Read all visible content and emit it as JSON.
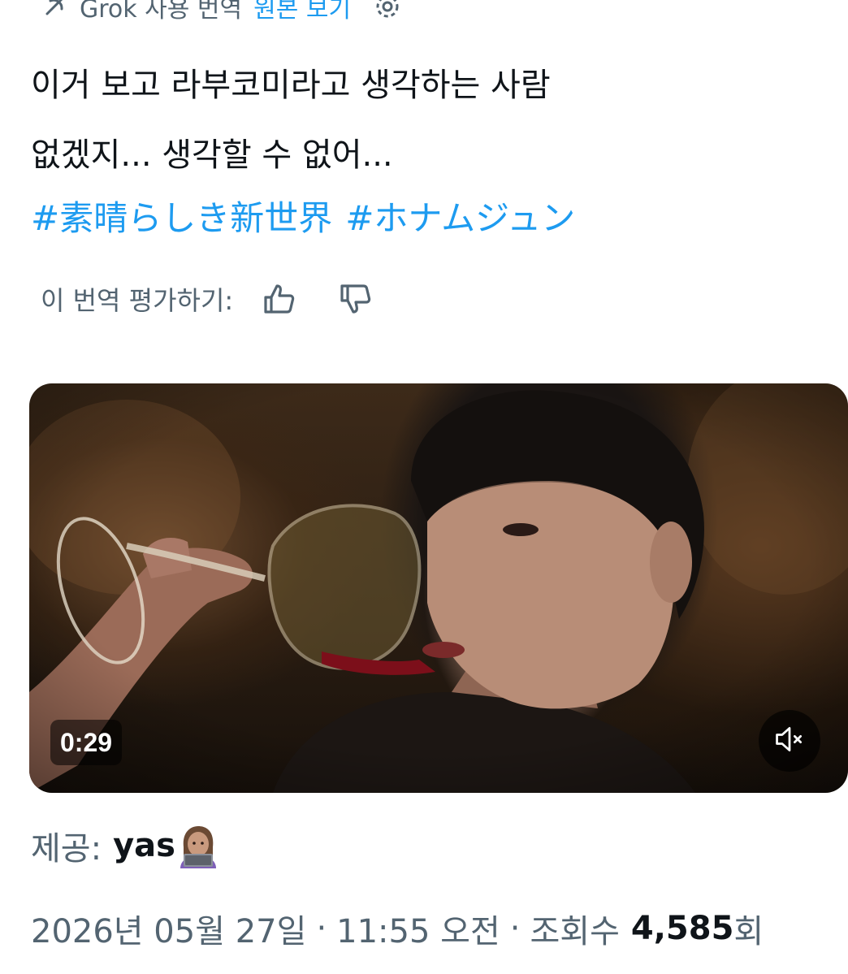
{
  "translation_bar": {
    "source": "Grok 사용 번역",
    "show_original": "원본 보기",
    "grok_icon": "grok-logo-icon",
    "settings_icon": "gear-icon"
  },
  "tweet": {
    "line1": "이거 보고 라부코미라고 생각하는 사람",
    "line2": "없겠지... 생각할 수 없어...",
    "hashtags": [
      "#素晴らしき新世界",
      "#ホナムジュン"
    ]
  },
  "rate_translation": {
    "label": "이 번역 평가하기:",
    "like_icon": "thumbs-up-icon",
    "dislike_icon": "thumbs-down-icon"
  },
  "video": {
    "duration": "0:29",
    "mute_icon": "speaker-muted-icon"
  },
  "credit": {
    "label": "제공:",
    "name": "yas",
    "emoji": "woman-technologist-emoji"
  },
  "meta": {
    "date": "2026년 05월 27일",
    "separator": "·",
    "time": "11:55 오전",
    "views_label": "조회수",
    "views_count": "4,585",
    "views_suffix": "회"
  },
  "colors": {
    "text_primary": "#0f1419",
    "text_secondary": "#536471",
    "link": "#1d9bf0"
  }
}
